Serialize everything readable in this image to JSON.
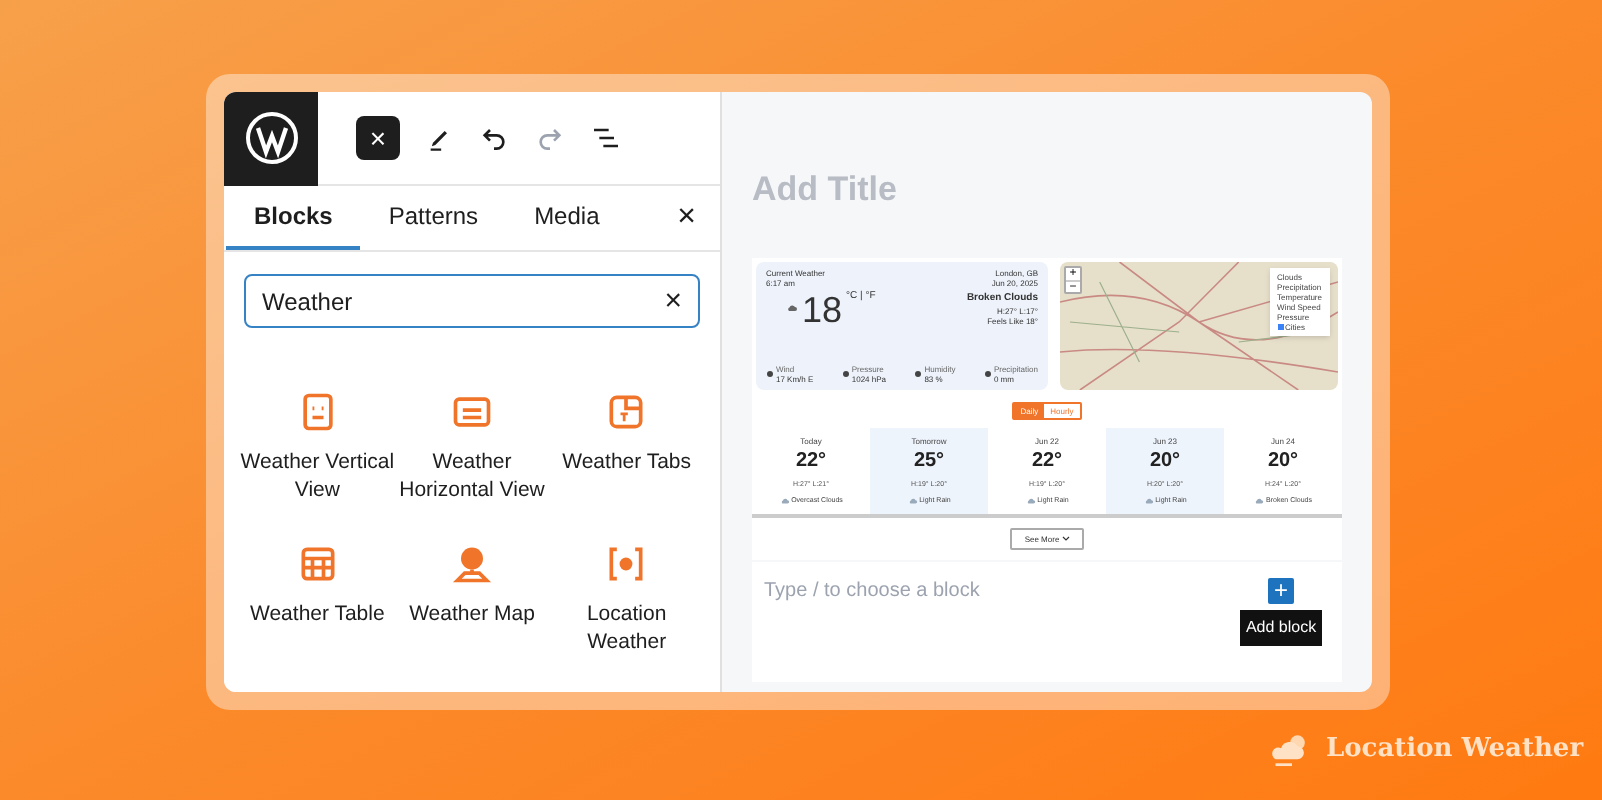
{
  "toolbar": {
    "close_symbol": "×"
  },
  "tabs": [
    {
      "label": "Blocks",
      "selected": true
    },
    {
      "label": "Patterns",
      "selected": false
    },
    {
      "label": "Media",
      "selected": false
    }
  ],
  "panel_close": "×",
  "search": {
    "value": "Weather",
    "clear": "×"
  },
  "blocks": [
    {
      "label": "Weather Vertical View",
      "kind": "vertical"
    },
    {
      "label": "Weather Horizontal View",
      "kind": "horizontal"
    },
    {
      "label": "Weather Tabs",
      "kind": "tabs"
    },
    {
      "label": "Weather Table",
      "kind": "table"
    },
    {
      "label": "Weather Map",
      "kind": "map"
    },
    {
      "label": "Location Weather",
      "kind": "location"
    }
  ],
  "editor": {
    "title_placeholder": "Add Title",
    "block_placeholder": "Type / to choose a block",
    "add_symbol": "+",
    "tooltip": "Add block"
  },
  "current_weather": {
    "heading": "Current Weather",
    "time": "6:17 am",
    "location": "London, GB",
    "date": "Jun 20, 2025",
    "temperature": "18",
    "units": "°C | °F",
    "condition": "Broken Clouds",
    "high_low": "H:27° L:17°",
    "feels_like": "Feels Like 18°",
    "stats": [
      {
        "label": "Wind",
        "value": "17 Km/h E"
      },
      {
        "label": "Pressure",
        "value": "1024 hPa"
      },
      {
        "label": "Humidity",
        "value": "83 %"
      },
      {
        "label": "Precipitation",
        "value": "0 mm"
      }
    ]
  },
  "map": {
    "zoom_in": "+",
    "zoom_out": "−",
    "layers": [
      {
        "label": "Clouds",
        "checked": false
      },
      {
        "label": "Precipitation",
        "checked": false
      },
      {
        "label": "Temperature",
        "checked": false
      },
      {
        "label": "Wind Speed",
        "checked": false
      },
      {
        "label": "Pressure",
        "checked": false
      },
      {
        "label": "Cities",
        "checked": true
      }
    ]
  },
  "forecast": {
    "tabs": [
      {
        "label": "Daily",
        "selected": true
      },
      {
        "label": "Hourly",
        "selected": false
      }
    ],
    "days": [
      {
        "day": "Today",
        "temp": "22°",
        "high_low": "H:27° L:21°",
        "condition": "Overcast Clouds",
        "highlighted": false
      },
      {
        "day": "Tomorrow",
        "temp": "25°",
        "high_low": "H:19° L:20°",
        "condition": "Light Rain",
        "highlighted": true
      },
      {
        "day": "Jun 22",
        "temp": "22°",
        "high_low": "H:19° L:20°",
        "condition": "Light Rain",
        "highlighted": false
      },
      {
        "day": "Jun 23",
        "temp": "20°",
        "high_low": "H:20° L:20°",
        "condition": "Light Rain",
        "highlighted": true
      },
      {
        "day": "Jun 24",
        "temp": "20°",
        "high_low": "H:24° L:20°",
        "condition": "Broken Clouds",
        "highlighted": false
      }
    ],
    "more": "See More"
  },
  "brand": {
    "name": "Location Weather"
  }
}
